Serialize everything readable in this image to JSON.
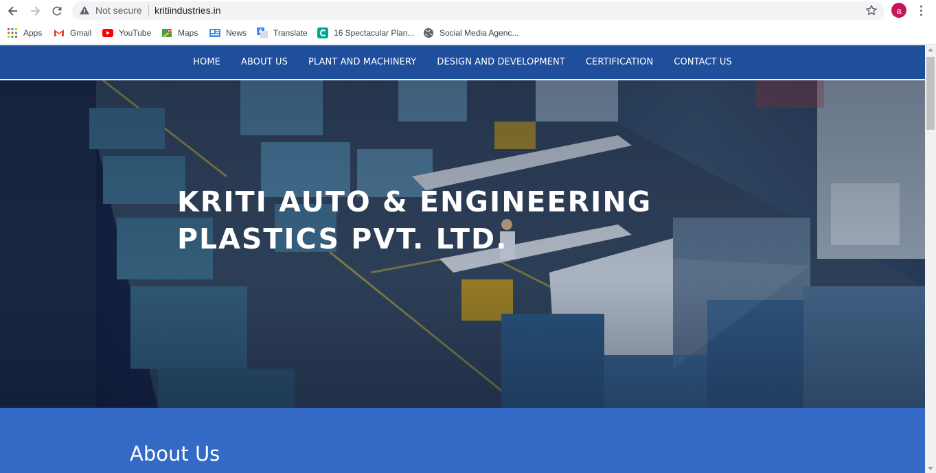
{
  "browser": {
    "security_label": "Not secure",
    "url": "kritiindustries.in",
    "profile_initial": "a",
    "bookmarks": [
      {
        "label": "Apps",
        "icon": "apps-grid-icon"
      },
      {
        "label": "Gmail",
        "icon": "gmail-icon"
      },
      {
        "label": "YouTube",
        "icon": "youtube-icon"
      },
      {
        "label": "Maps",
        "icon": "maps-icon"
      },
      {
        "label": "News",
        "icon": "news-icon"
      },
      {
        "label": "Translate",
        "icon": "translate-icon"
      },
      {
        "label": "16 Spectacular Plan...",
        "icon": "site-c-icon"
      },
      {
        "label": "Social Media Agenc...",
        "icon": "globe-icon"
      }
    ]
  },
  "site": {
    "nav": [
      {
        "label": "HOME"
      },
      {
        "label": "ABOUT US"
      },
      {
        "label": "PLANT AND MACHINERY"
      },
      {
        "label": "DESIGN AND DEVELOPMENT"
      },
      {
        "label": "CERTIFICATION"
      },
      {
        "label": "CONTACT US"
      }
    ],
    "hero": {
      "title_line1": "KRITI AUTO & ENGINEERING",
      "title_line2": "PLASTICS PVT. LTD."
    },
    "about": {
      "heading": "About Us"
    }
  },
  "colors": {
    "nav_bg": "#1f4e9c",
    "about_bg": "#3469c6",
    "avatar_bg": "#c2185b"
  }
}
